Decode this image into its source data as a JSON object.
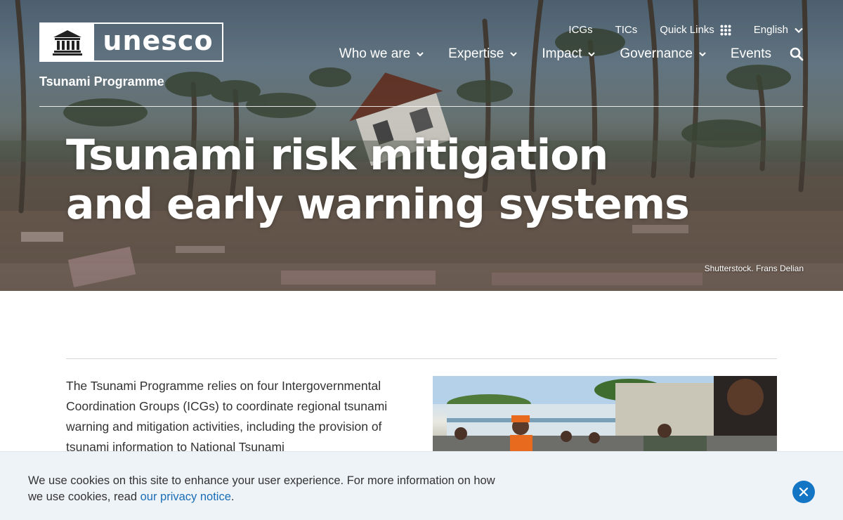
{
  "site": {
    "brand": "unesco",
    "programme": "Tsunami Programme"
  },
  "utility_nav": {
    "items": [
      {
        "label": "ICGs"
      },
      {
        "label": "TICs"
      },
      {
        "label": "Quick Links",
        "icon": "grid-icon"
      },
      {
        "label": "English",
        "icon": "chevron-down-icon"
      }
    ]
  },
  "main_nav": {
    "items": [
      {
        "label": "Who we are",
        "has_dropdown": true
      },
      {
        "label": "Expertise",
        "has_dropdown": true
      },
      {
        "label": "Impact",
        "has_dropdown": true
      },
      {
        "label": "Governance",
        "has_dropdown": true
      },
      {
        "label": "Events",
        "has_dropdown": false
      }
    ],
    "search_icon": "search-icon"
  },
  "hero": {
    "title": "Tsunami risk mitigation and early warning systems",
    "credit": "Shutterstock. Frans Delian"
  },
  "content": {
    "intro": "The Tsunami Programme relies on four Intergovernmental Coordination Groups (ICGs) to coordinate regional tsunami warning and mitigation activities, including the provision of tsunami information to National Tsunami"
  },
  "cookie_banner": {
    "text_before_link": "We use cookies on this site to enhance your user experience. For more information on how we use cookies, read ",
    "link_label": "our privacy notice",
    "text_after_link": ".",
    "close_icon": "close-icon"
  },
  "colors": {
    "accent_blue": "#1475c4",
    "link_blue": "#1a6db5",
    "cookie_bg": "#eef3f8"
  }
}
